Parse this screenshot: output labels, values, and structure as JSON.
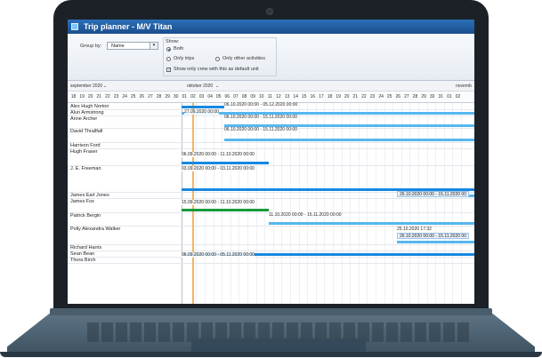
{
  "window": {
    "title": "Trip planner - M/V Titan"
  },
  "toolbar": {
    "group_by_label": "Group by:",
    "group_by_value": "Name",
    "show_label": "Show:",
    "radio_both": "Both",
    "radio_only_trips": "Only trips",
    "radio_only_other": "Only other activities",
    "checkbox_default_unit": "Show only crew with this as default unit"
  },
  "timeline": {
    "months": [
      "september 2020",
      "oktober 2020",
      "novemb"
    ],
    "days": [
      "18",
      "19",
      "20",
      "21",
      "22",
      "23",
      "24",
      "25",
      "26",
      "27",
      "28",
      "29",
      "30",
      "01",
      "02",
      "03",
      "04",
      "05",
      "06",
      "07",
      "08",
      "09",
      "10",
      "11",
      "12",
      "13",
      "14",
      "15",
      "16",
      "17",
      "18",
      "19",
      "20",
      "21",
      "22",
      "23",
      "24",
      "25",
      "26",
      "27",
      "28",
      "29",
      "30",
      "31",
      "01",
      "02"
    ]
  },
  "crew": [
    {
      "name": "Alex Hugh Norton"
    },
    {
      "name": "Alun Armstrong"
    },
    {
      "name": "Anne Archer"
    },
    {
      "name": "David Thrallfall"
    },
    {
      "name": "Harrison Ford"
    },
    {
      "name": "Hugh Fraser"
    },
    {
      "name": "J. E. Freeman"
    },
    {
      "name": "James Earl Jones"
    },
    {
      "name": "James Fox"
    },
    {
      "name": "Patrick Bergin"
    },
    {
      "name": "Polly Alexandra Walker"
    },
    {
      "name": "Richard Harris"
    },
    {
      "name": "Sean Bean"
    },
    {
      "name": "Thora Birch"
    }
  ],
  "assignments": [
    {
      "label": "06.10.2020 00:00 - 05.12.2020 00:00"
    },
    {
      "label": "27.09.2020 00:00"
    },
    {
      "label": "06.10.2020 00:00 - 15.11.2020 00:00"
    },
    {
      "label": "06.10.2020 00:00 - 15.11.2020 00:00"
    },
    {
      "label": "06.09.2020 00:00 - 11.10.2020 00:00"
    },
    {
      "label": "03.09.2020 00:00 - 03.11.2020 00:00"
    },
    {
      "label": "26.10.2020 00:00 - 15.11.2020 00"
    },
    {
      "label": "15.09.2020 00:00 - 11.10.2020 00:00"
    },
    {
      "label": "11.10.2020 00:00 - 15.11.2020 00:00"
    },
    {
      "label": "25.10.2020 17:32"
    },
    {
      "label": "26.10.2020 00:00 - 15.11.2020 00"
    },
    {
      "label": "06.09.2020 00:00 - 05.11.2020 00:00"
    }
  ],
  "colors": {
    "titlebar": "#1b4e8c",
    "trip_bar": "#1688e0",
    "activity_bar": "#159a3b",
    "today_marker": "#f2b566"
  }
}
